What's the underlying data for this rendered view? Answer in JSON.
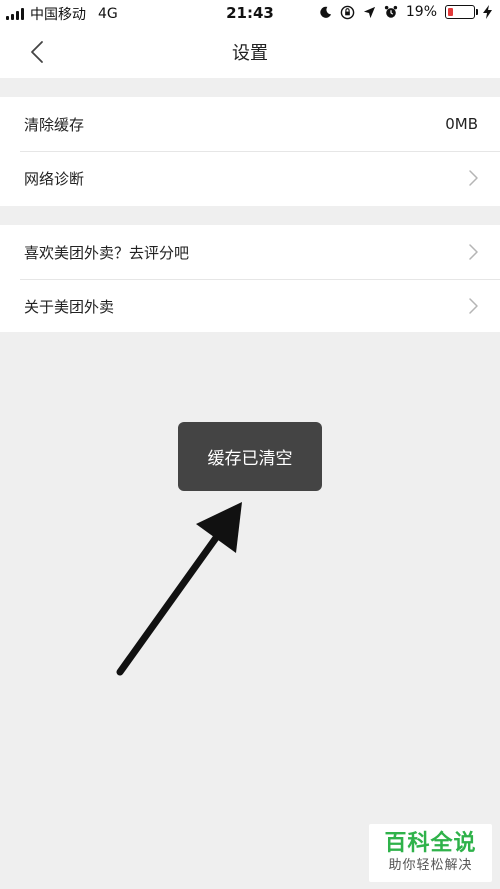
{
  "status_bar": {
    "carrier": "中国移动",
    "network": "4G",
    "time": "21:43",
    "battery_percent": "19%",
    "battery_level": 0.19,
    "battery_color": "#e23a3a"
  },
  "nav": {
    "title": "设置"
  },
  "settings": {
    "section1": [
      {
        "label": "清除缓存",
        "value": "0MB"
      },
      {
        "label": "网络诊断"
      }
    ],
    "section2": [
      {
        "label": "喜欢美团外卖？去评分吧"
      },
      {
        "label": "关于美团外卖"
      }
    ]
  },
  "toast": {
    "message": "缓存已清空"
  },
  "watermark": {
    "title": "百科全说",
    "subtitle": "助你轻松解决"
  },
  "colors": {
    "background": "#efefef",
    "toast": "#444444",
    "watermark_green": "#2fb24a"
  }
}
